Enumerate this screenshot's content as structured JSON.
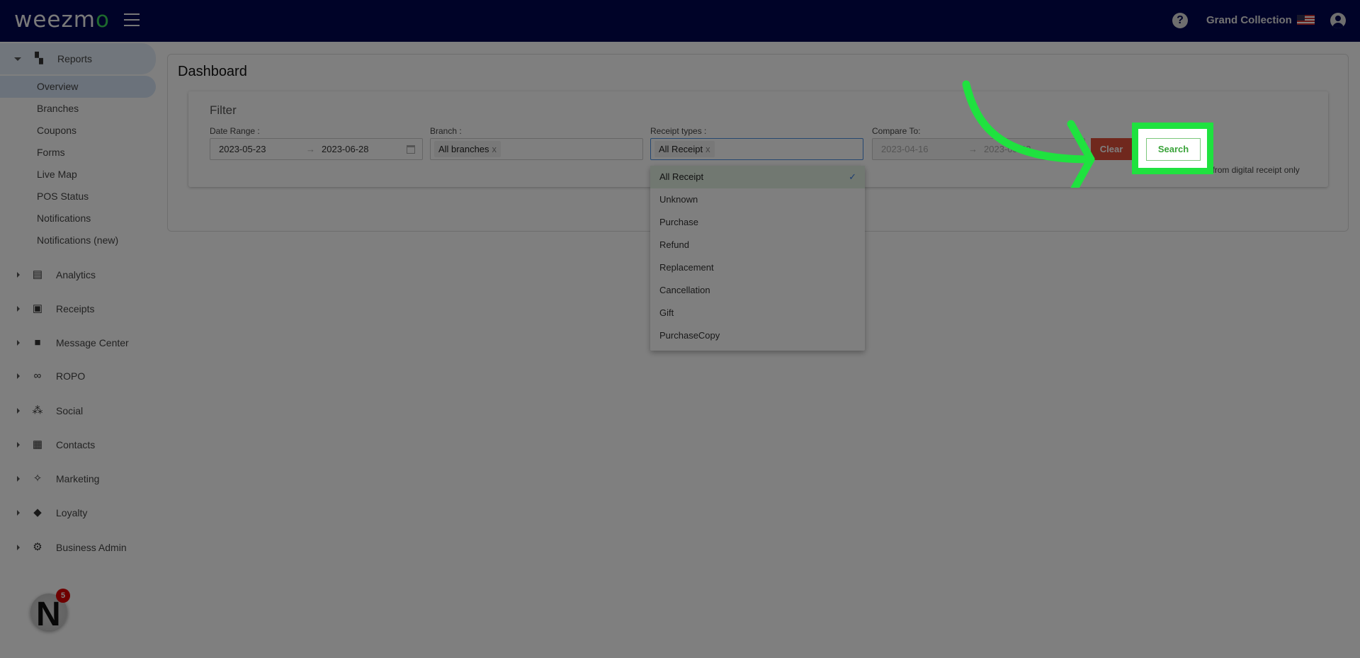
{
  "header": {
    "logo": "weezmo",
    "org": "Grand Collection",
    "icons": [
      "menu-icon",
      "help-icon",
      "us-flag-icon",
      "user-account-icon"
    ]
  },
  "sidebar": {
    "reports": {
      "label": "Reports",
      "items": [
        "Overview",
        "Branches",
        "Coupons",
        "Forms",
        "Live Map",
        "POS Status",
        "Notifications",
        "Notifications (new)"
      ],
      "active": "Overview"
    },
    "sections": [
      {
        "label": "Analytics",
        "icon": "analytics-icon"
      },
      {
        "label": "Receipts",
        "icon": "receipt-icon"
      },
      {
        "label": "Message Center",
        "icon": "chat-icon"
      },
      {
        "label": "ROPO",
        "icon": "infinity-icon"
      },
      {
        "label": "Social",
        "icon": "people-icon"
      },
      {
        "label": "Contacts",
        "icon": "contacts-icon"
      },
      {
        "label": "Marketing",
        "icon": "party-popper-icon"
      },
      {
        "label": "Loyalty",
        "icon": "tag-heart-icon"
      },
      {
        "label": "Business Admin",
        "icon": "gear-icon"
      }
    ],
    "notifications_badge": "5",
    "avatar_letter": "N"
  },
  "main": {
    "title": "Dashboard",
    "filter": {
      "title": "Filter",
      "date_range": {
        "label": "Date Range :",
        "start": "2023-05-23",
        "end": "2023-06-28"
      },
      "branch": {
        "label": "Branch :",
        "value": "All branches"
      },
      "receipt_types": {
        "label": "Receipt types :",
        "value": "All Receipt",
        "options": [
          "All Receipt",
          "Unknown",
          "Purchase",
          "Refund",
          "Replacement",
          "Cancellation",
          "Gift",
          "PurchaseCopy"
        ],
        "selected": "All Receipt"
      },
      "compare_to": {
        "label": "Compare To:",
        "start": "2023-04-16",
        "end": "2023-05-22"
      },
      "clear_label": "Clear",
      "search_label": "Search",
      "note": "* Information from digital receipt only"
    }
  },
  "colors": {
    "header": "#000650",
    "highlight": "#1fe23f",
    "clear": "#e0503a",
    "search": "#3aa33a"
  }
}
